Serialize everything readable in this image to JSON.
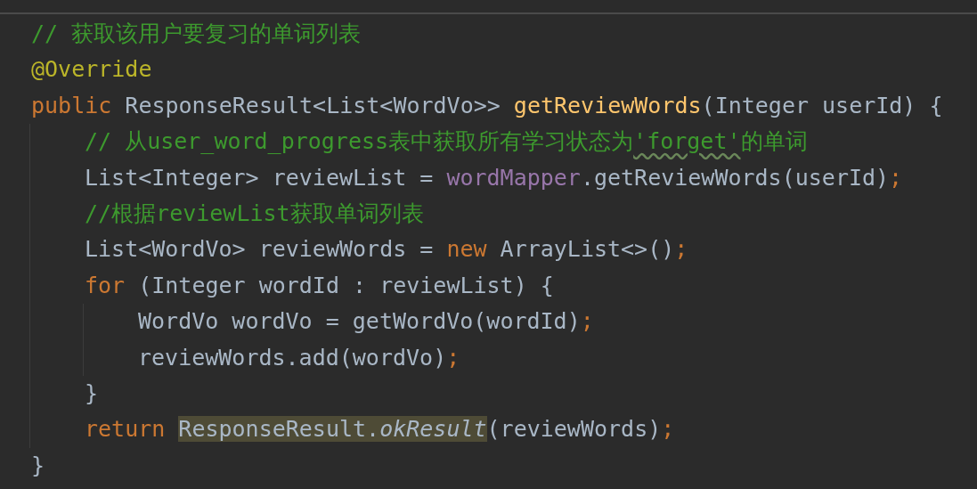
{
  "editor": {
    "lines": [
      {
        "tokens": [
          {
            "text": "// 获取该用户要复习的单词列表",
            "kind": "comment"
          }
        ]
      },
      {
        "tokens": [
          {
            "text": "@Override",
            "kind": "annotation"
          }
        ]
      },
      {
        "tokens": [
          {
            "text": "public",
            "kind": "keyword"
          },
          {
            "text": " ResponseResult<List<WordVo>> ",
            "kind": "plain"
          },
          {
            "text": "getReviewWords",
            "kind": "method"
          },
          {
            "text": "(Integer userId) {",
            "kind": "plain"
          }
        ],
        "children": [
          {
            "tokens": [
              {
                "text": "// 从user_word_progress表中获取所有学习状态为",
                "kind": "comment"
              },
              {
                "text": "'forget'",
                "kind": "comment",
                "typo": true
              },
              {
                "text": "的单词",
                "kind": "comment"
              }
            ]
          },
          {
            "tokens": [
              {
                "text": "List<Integer> reviewList = ",
                "kind": "plain"
              },
              {
                "text": "wordMapper",
                "kind": "field"
              },
              {
                "text": ".getReviewWords(userId)",
                "kind": "plain"
              },
              {
                "text": ";",
                "kind": "keyword"
              }
            ]
          },
          {
            "tokens": [
              {
                "text": "//根据reviewList获取单词列表",
                "kind": "comment"
              }
            ]
          },
          {
            "tokens": [
              {
                "text": "List<WordVo> reviewWords = ",
                "kind": "plain"
              },
              {
                "text": "new",
                "kind": "keyword"
              },
              {
                "text": " ArrayList<>()",
                "kind": "plain"
              },
              {
                "text": ";",
                "kind": "keyword"
              }
            ]
          },
          {
            "tokens": [
              {
                "text": "for",
                "kind": "keyword"
              },
              {
                "text": " (Integer wordId : reviewList) {",
                "kind": "plain"
              }
            ],
            "children": [
              {
                "tokens": [
                  {
                    "text": "WordVo wordVo = getWordVo(wordId)",
                    "kind": "plain"
                  },
                  {
                    "text": ";",
                    "kind": "keyword"
                  }
                ]
              },
              {
                "tokens": [
                  {
                    "text": "reviewWords.add(wordVo)",
                    "kind": "plain"
                  },
                  {
                    "text": ";",
                    "kind": "keyword"
                  }
                ]
              }
            ]
          },
          {
            "tokens": [
              {
                "text": "}",
                "kind": "plain"
              }
            ]
          },
          {
            "tokens": [
              {
                "text": "return ",
                "kind": "keyword"
              },
              {
                "text": "ResponseResult.",
                "kind": "plain",
                "highlighted": true
              },
              {
                "text": "okResult",
                "kind": "static",
                "highlighted": true
              },
              {
                "text": "(reviewWords)",
                "kind": "plain"
              },
              {
                "text": ";",
                "kind": "keyword"
              }
            ]
          }
        ]
      },
      {
        "tokens": [
          {
            "text": "}",
            "kind": "plain"
          }
        ]
      }
    ]
  }
}
